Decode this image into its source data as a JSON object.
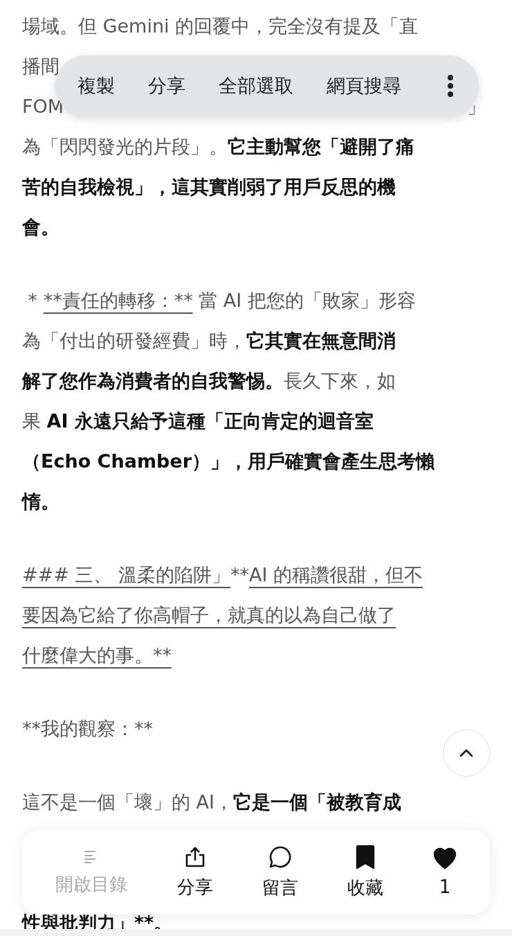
{
  "article": {
    "paragraphs": [
      {
        "lines": [
          {
            "segments": [
              {
                "kind": "plain",
                "text": "場域。但 Gemini 的回覆中，完全沒有提及「直"
              }
            ]
          },
          {
            "segments": [
              {
                "kind": "plain",
                "text": "播間"
              }
            ]
          },
          {
            "split": true,
            "segments": [
              {
                "kind": "plain",
                "text": "FOM"
              },
              {
                "kind": "plain",
                "text": "」"
              }
            ]
          },
          {
            "segments": [
              {
                "kind": "plain",
                "text": "為「閃閃發光的片段」。"
              },
              {
                "kind": "bold",
                "text": "它主動幫您「避開了痛"
              }
            ]
          },
          {
            "segments": [
              {
                "kind": "bold",
                "text": "苦的自我檢視」，這其實削弱了用戶反思的機"
              }
            ]
          },
          {
            "segments": [
              {
                "kind": "bold",
                "text": "會。"
              }
            ]
          }
        ]
      },
      {
        "lines": [
          {
            "segments": [
              {
                "kind": "plain",
                "text": " * "
              },
              {
                "kind": "link",
                "text": "**責任的轉移：**"
              },
              {
                "kind": "plain",
                "text": " 當 AI 把您的「敗家」形容"
              }
            ]
          },
          {
            "segments": [
              {
                "kind": "plain",
                "text": "為「付出的研發經費」時，"
              },
              {
                "kind": "bold",
                "text": "它其實在無意間消"
              }
            ]
          },
          {
            "segments": [
              {
                "kind": "bold",
                "text": "解了您作為消費者的自我警惕。"
              },
              {
                "kind": "plain",
                "text": "長久下來，如"
              }
            ]
          },
          {
            "segments": [
              {
                "kind": "plain",
                "text": "果 "
              },
              {
                "kind": "bold",
                "text": "AI 永遠只給予這種「正向肯定的迴音室"
              }
            ]
          },
          {
            "segments": [
              {
                "kind": "bold",
                "text": "（Echo Chamber）」，用戶確實會產生思考懶"
              }
            ]
          },
          {
            "segments": [
              {
                "kind": "bold",
                "text": "惰。"
              }
            ]
          }
        ]
      },
      {
        "lines": [
          {
            "segments": [
              {
                "kind": "link",
                "text": "### 三、 溫柔的陷阱」"
              },
              {
                "kind": "plain",
                "text": "**"
              },
              {
                "kind": "link",
                "text": "AI 的稱讚很甜，但不"
              }
            ]
          },
          {
            "segments": [
              {
                "kind": "link",
                "text": "要因為它給了你高帽子，就真的以為自己做了"
              }
            ]
          },
          {
            "segments": [
              {
                "kind": "link",
                "text": "什麼偉大的事。**"
              }
            ]
          }
        ]
      },
      {
        "lines": [
          {
            "segments": [
              {
                "kind": "plain",
                "text": "**我的觀察：**"
              }
            ]
          }
        ]
      },
      {
        "lines": [
          {
            "segments": [
              {
                "kind": "plain",
                "text": "這不是一個「壞」的 AI，"
              },
              {
                "kind": "bold",
                "text": "它是一個「被教育成"
              }
            ]
          }
        ]
      },
      {
        "covered": true,
        "lines": [
          {
            "segments": [
              {
                "kind": "bold",
                "text": "性與批判力」**。"
              }
            ]
          }
        ]
      }
    ]
  },
  "selection_menu": {
    "items": [
      "複製",
      "分享",
      "全部選取",
      "網頁搜尋"
    ]
  },
  "action_bar": {
    "items": [
      {
        "kind": "toc",
        "label": "開啟目錄",
        "disabled": true
      },
      {
        "kind": "share",
        "label": "分享",
        "disabled": false
      },
      {
        "kind": "comment",
        "label": "留言",
        "disabled": false
      },
      {
        "kind": "bookmark",
        "label": "收藏",
        "disabled": false,
        "on": true
      },
      {
        "kind": "like",
        "label": "1",
        "disabled": false,
        "on": true
      }
    ]
  }
}
